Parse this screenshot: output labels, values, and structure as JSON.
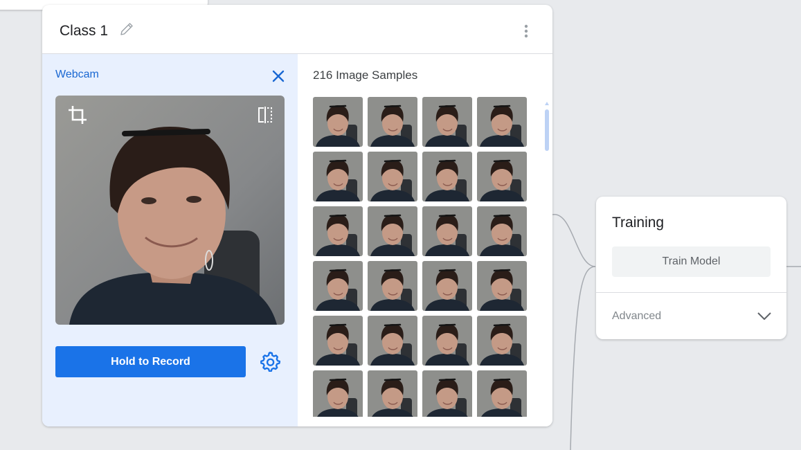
{
  "class_card": {
    "title": "Class 1",
    "webcam": {
      "label": "Webcam",
      "record_label": "Hold to Record"
    },
    "samples": {
      "title": "216 Image Samples",
      "visible_rows": 6,
      "columns": 4
    }
  },
  "training_card": {
    "title": "Training",
    "train_label": "Train Model",
    "advanced_label": "Advanced"
  },
  "colors": {
    "accent": "#1a73e8",
    "webcam_panel": "#e8f0fe",
    "canvas_bg": "#e8eaed"
  },
  "icons": [
    "edit-icon",
    "more-vert-icon",
    "close-icon",
    "crop-icon",
    "flip-icon",
    "settings-icon",
    "chevron-down-icon"
  ]
}
